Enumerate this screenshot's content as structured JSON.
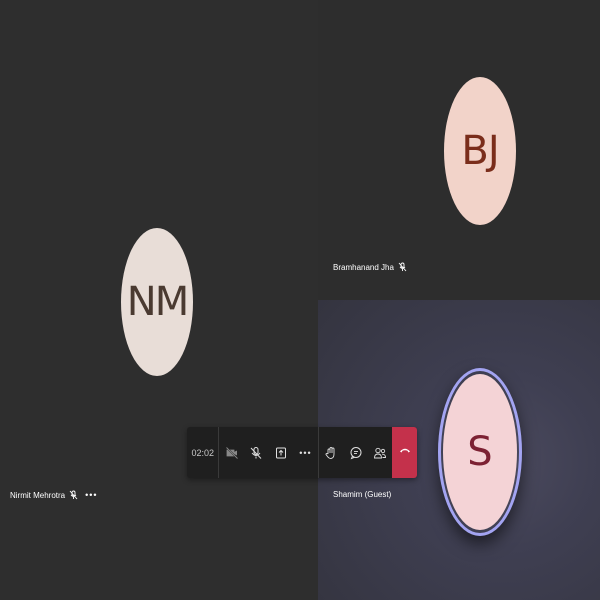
{
  "participants": [
    {
      "initials": "NM",
      "name": "Nirmit Mehrotra",
      "muted": true
    },
    {
      "initials": "BJ",
      "name": "Bramhanand Jha",
      "muted": true
    },
    {
      "initials": "S",
      "name": "Shamim (Guest)",
      "muted": false,
      "speaking": true
    }
  ],
  "toolbar": {
    "timer": "02:02",
    "more_label": "•••"
  },
  "more_options_label": "•••",
  "colors": {
    "hangup": "#c4314b",
    "speaking_ring": "#a3a4f2",
    "tile_background": "#2e2e2e"
  },
  "icons": [
    "video-off-icon",
    "mic-off-icon",
    "share-screen-icon",
    "more-icon",
    "raise-hand-icon",
    "chat-icon",
    "participants-icon",
    "hang-up-icon"
  ]
}
